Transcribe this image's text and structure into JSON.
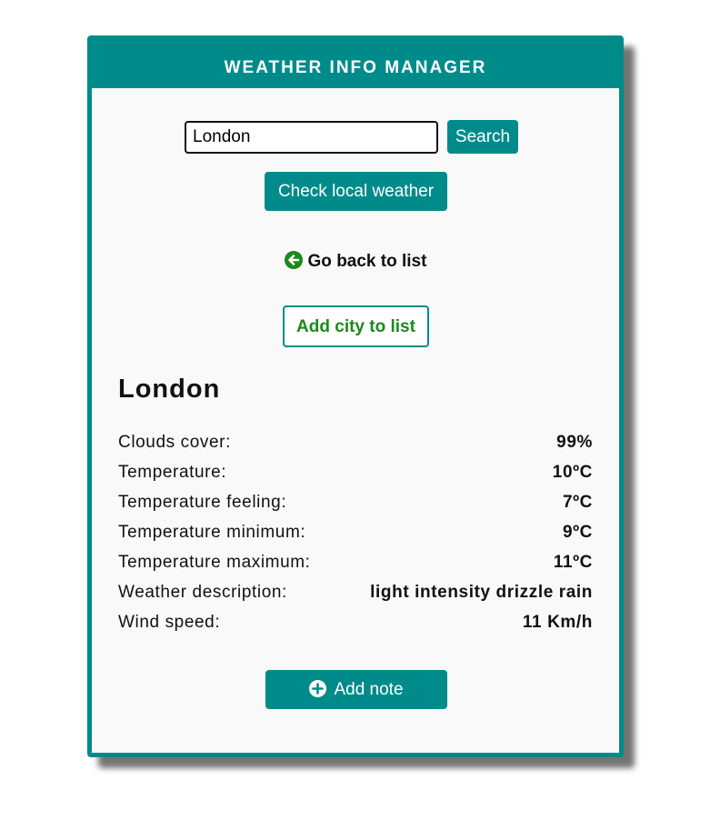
{
  "app": {
    "title": "WEATHER INFO MANAGER"
  },
  "search": {
    "value": "London",
    "button_label": "Search"
  },
  "local_weather": {
    "label": "Check local weather"
  },
  "back_link": {
    "label": "Go back to list",
    "icon": "arrow-left-circle-icon",
    "color": "#1a8a1a"
  },
  "add_city": {
    "label": "Add city to list"
  },
  "city": {
    "name": "London"
  },
  "weather": {
    "rows": [
      {
        "label": "Clouds cover:",
        "value": "99%"
      },
      {
        "label": "Temperature:",
        "value": "10ºC"
      },
      {
        "label": "Temperature feeling:",
        "value": "7ºC"
      },
      {
        "label": "Temperature minimum:",
        "value": "9ºC"
      },
      {
        "label": "Temperature maximum:",
        "value": "11ºC"
      },
      {
        "label": "Weather description:",
        "value": "light intensity drizzle rain"
      },
      {
        "label": "Wind speed:",
        "value": "11 Km/h"
      }
    ]
  },
  "add_note": {
    "label": "Add note",
    "icon": "plus-circle-icon"
  },
  "colors": {
    "accent": "#008b8b",
    "link_green": "#1a8a1a",
    "background": "#f9f9f9"
  }
}
